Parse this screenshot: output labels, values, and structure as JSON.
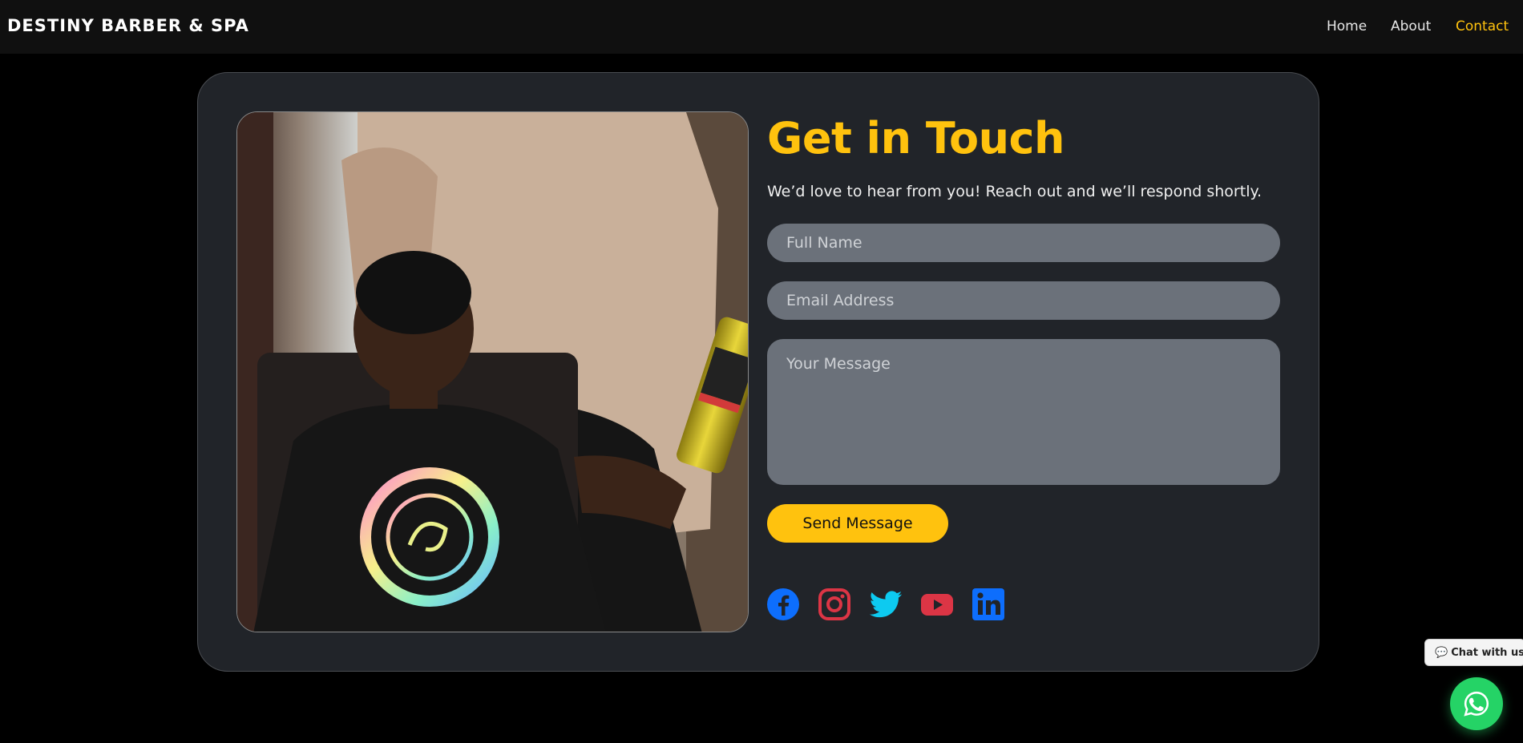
{
  "nav": {
    "brand": "DESTINY BARBER & SPA",
    "links": [
      {
        "label": "Home"
      },
      {
        "label": "About"
      },
      {
        "label": "Contact",
        "active": true
      }
    ],
    "active_color": "#ffc20e"
  },
  "contact": {
    "title": "Get in Touch",
    "subtitle": "We’d love to hear from you! Reach out and we’ll respond shortly.",
    "fields": {
      "name_placeholder": "Full Name",
      "email_placeholder": "Email Address",
      "message_placeholder": "Your Message"
    },
    "send_label": "Send Message",
    "accent": "#ffc20e"
  },
  "social": [
    {
      "icon": "facebook-icon",
      "color": "#0d6efd"
    },
    {
      "icon": "instagram-icon",
      "color": "#dc3545"
    },
    {
      "icon": "twitter-icon",
      "color": "#0dcaf0"
    },
    {
      "icon": "youtube-icon",
      "color": "#dc3545"
    },
    {
      "icon": "linkedin-icon",
      "color": "#0d6efd"
    }
  ],
  "chat": {
    "label": "Chat with us",
    "icon": "whatsapp-icon",
    "color": "#25d366"
  }
}
